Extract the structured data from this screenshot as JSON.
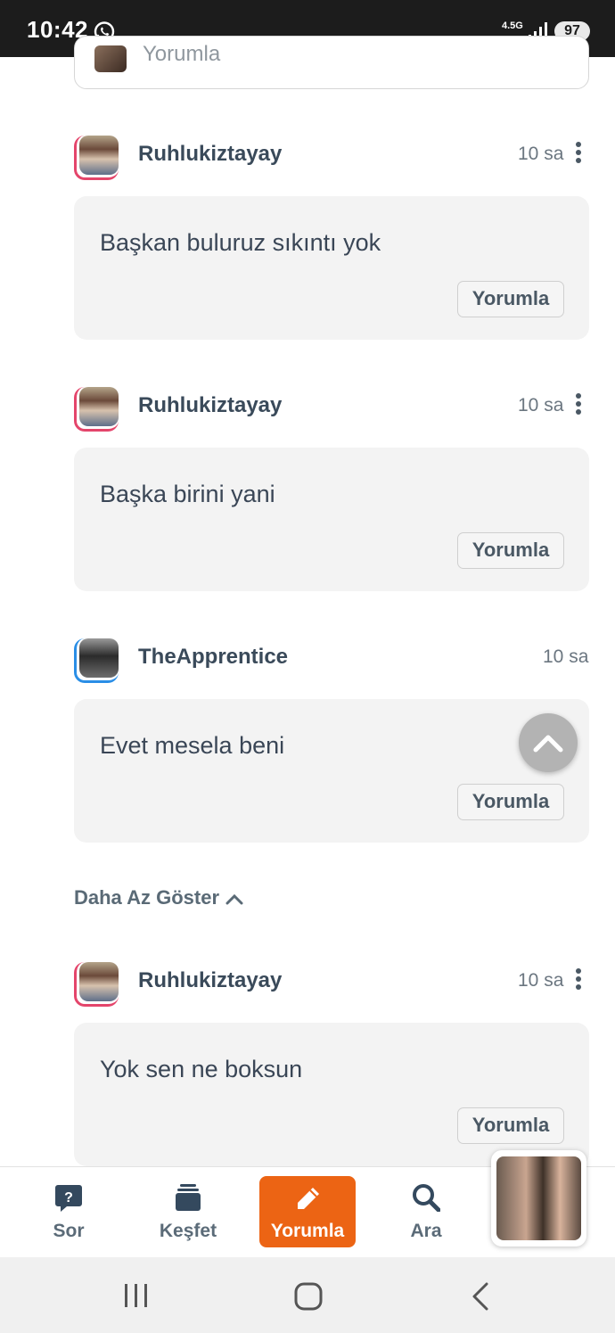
{
  "status_bar": {
    "time": "10:42",
    "network": "4.5G",
    "battery": "97"
  },
  "top_card": {
    "placeholder": "Yorumla"
  },
  "comments": [
    {
      "username": "Ruhlukiztayay",
      "time": "10 sa",
      "text": "Başkan buluruz sıkıntı yok",
      "reply_label": "Yorumla",
      "avatar_ring": "#e4456b"
    },
    {
      "username": "Ruhlukiztayay",
      "time": "10 sa",
      "text": "Başka birini yani",
      "reply_label": "Yorumla",
      "avatar_ring": "#e4456b"
    },
    {
      "username": "TheApprentice",
      "time": "10 sa",
      "text": "Evet mesela beni",
      "reply_label": "Yorumla",
      "avatar_ring": "#2a8ee6"
    },
    {
      "username": "Ruhlukiztayay",
      "time": "10 sa",
      "text": "Yok sen ne boksun",
      "reply_label": "Yorumla",
      "avatar_ring": "#e4456b"
    }
  ],
  "show_less": "Daha Az Göster",
  "bottom_nav": {
    "items": [
      {
        "label": "Sor",
        "icon": "question-bubble-icon"
      },
      {
        "label": "Keşfet",
        "icon": "stack-icon"
      },
      {
        "label": "Yorumla",
        "icon": "pencil-icon",
        "active": true
      },
      {
        "label": "Ara",
        "icon": "search-icon"
      }
    ]
  },
  "colors": {
    "accent": "#ec6414",
    "bubble": "#f3f3f3",
    "text": "#3a4656"
  }
}
